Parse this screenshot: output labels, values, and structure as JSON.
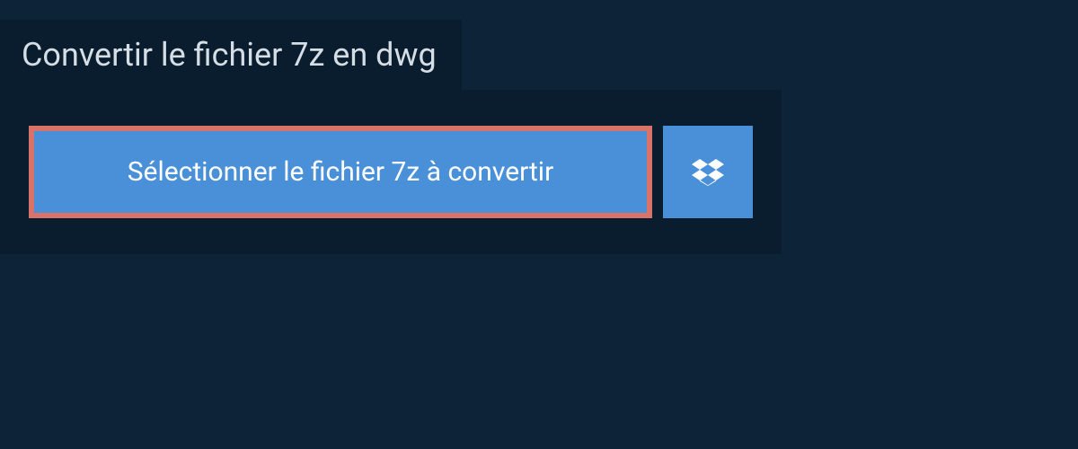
{
  "header": {
    "title": "Convertir le fichier 7z en dwg"
  },
  "actions": {
    "select_file_label": "Sélectionner le fichier 7z à convertir"
  },
  "colors": {
    "background": "#0d2438",
    "panel": "#0a1d2e",
    "button": "#4a90d9",
    "highlight_border": "#d9736a",
    "text_light": "#d5dde5"
  }
}
